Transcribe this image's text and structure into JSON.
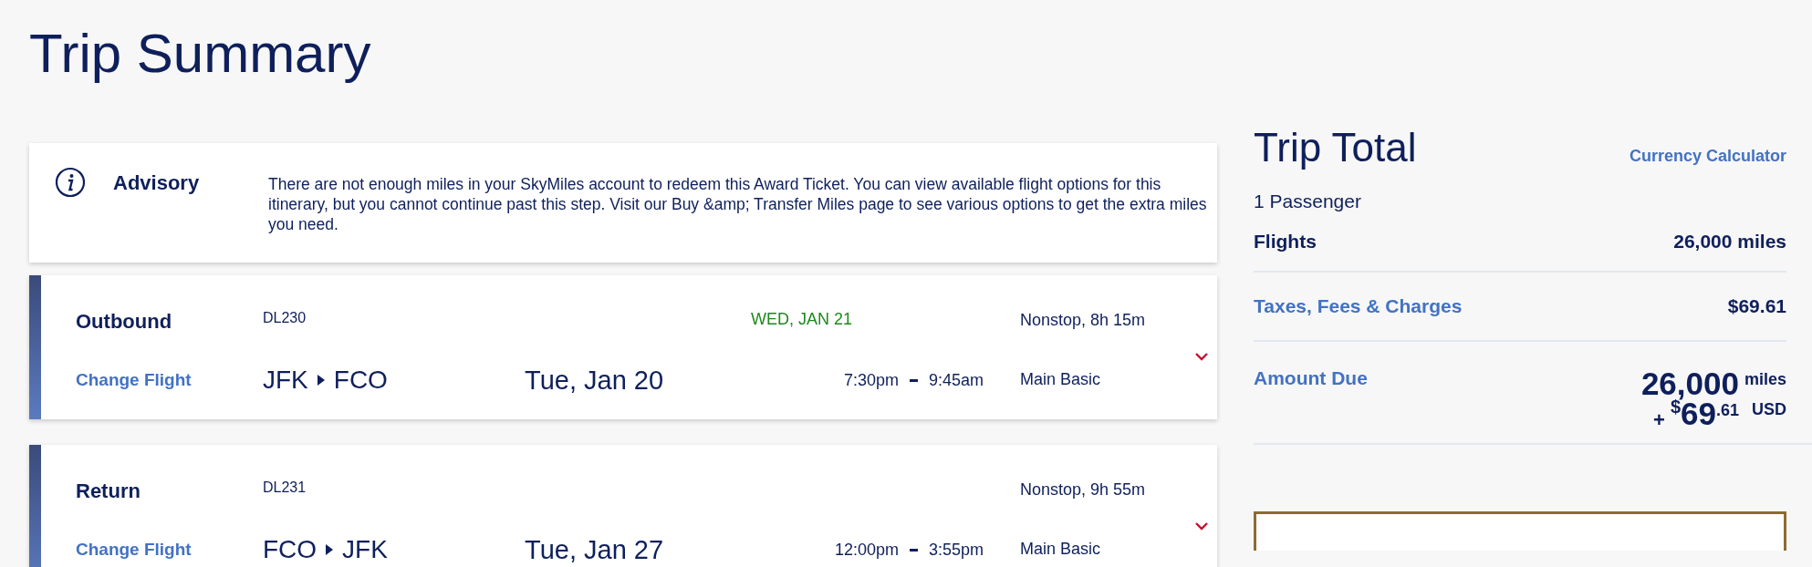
{
  "page_title": "Trip Summary",
  "advisory": {
    "title": "Advisory",
    "message": "There are not enough miles in your SkyMiles account to redeem this Award Ticket. You can view available flight options for this itinerary, but you cannot continue past this step. Visit our Buy &amp; Transfer Miles page to see various options to get the extra miles you need."
  },
  "flights": [
    {
      "label": "Outbound",
      "change_link": "Change Flight",
      "flight_number": "DL230",
      "origin": "JFK",
      "destination": "FCO",
      "date": "Tue, Jan 20",
      "arrival_date": "WED, JAN 21",
      "depart_time": "7:30pm",
      "arrive_time": "9:45am",
      "stops": "Nonstop, 8h 15m",
      "fare_class": "Main Basic",
      "expanded": false
    },
    {
      "label": "Return",
      "change_link": "Change Flight",
      "flight_number": "DL231",
      "origin": "FCO",
      "destination": "JFK",
      "date": "Tue, Jan 27",
      "depart_time": "12:00pm",
      "arrive_time": "3:55pm",
      "stops": "Nonstop, 9h 55m",
      "fare_class": "Main Basic",
      "expanded": false
    }
  ],
  "trip_total": {
    "title": "Trip Total",
    "currency_link": "Currency Calculator",
    "passengers": "1 Passenger",
    "lines": [
      {
        "label": "Flights",
        "value": "26,000 miles",
        "kind": "plain"
      },
      {
        "label": "Taxes, Fees & Charges",
        "value": "$69.61",
        "kind": "link"
      }
    ],
    "amount_due": {
      "label": "Amount Due",
      "miles": "26,000",
      "miles_unit": "miles",
      "plus": "+",
      "currency_symbol": "$",
      "dollars": "69",
      "cents": ".61",
      "currency": "USD"
    }
  }
}
